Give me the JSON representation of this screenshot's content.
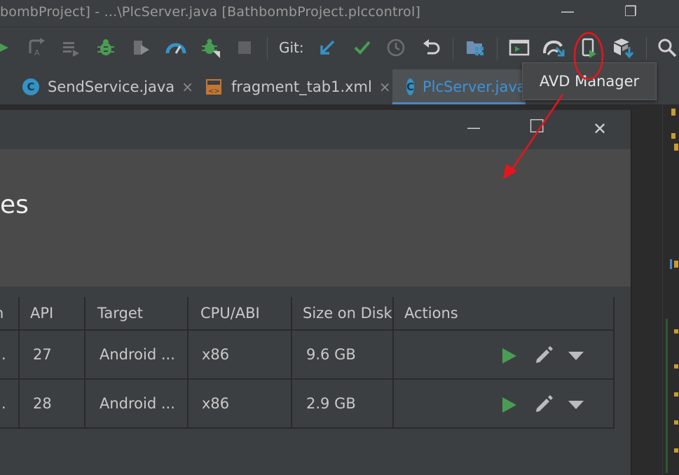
{
  "window": {
    "title": "bombProject] - ...\\PlcServer.java [BathbombProject.plccontrol]",
    "minimize_glyph": "—",
    "restore_glyph": "❐"
  },
  "toolbar": {
    "git_label": "Git:",
    "icons": [
      "run-icon",
      "rerun-icon",
      "coverage-icon",
      "debug-icon",
      "profile-icon",
      "speed-icon",
      "attach-debugger-icon",
      "stop-icon",
      "git-update-icon",
      "git-commit-icon",
      "git-history-icon",
      "revert-icon",
      "project-structure-icon",
      "terminal-icon",
      "sync-gradle-icon",
      "avd-manager-icon",
      "sdk-manager-icon",
      "search-icon"
    ]
  },
  "tabs": [
    {
      "label": "SendService.java",
      "icon": "class-icon",
      "close": "×"
    },
    {
      "label": "fragment_tab1.xml",
      "icon": "layout-icon",
      "close": "×"
    },
    {
      "label": "PlcServer.java",
      "icon": "class-icon",
      "close": ""
    }
  ],
  "tooltip": {
    "text": "AVD Manager"
  },
  "dialog": {
    "title_fragment": "es",
    "minimize_glyph": "—",
    "maximize_glyph": "☐",
    "close_glyph": "✕"
  },
  "table": {
    "columns": [
      "n",
      "API",
      "Target",
      "CPU/ABI",
      "Size on Disk",
      "Actions"
    ],
    "rows": [
      {
        "name_fragment": ".",
        "api": "27",
        "target": "Android ...",
        "cpu": "x86",
        "size": "9.6 GB"
      },
      {
        "name_fragment": ".",
        "api": "28",
        "target": "Android ...",
        "cpu": "x86",
        "size": "2.9 GB"
      }
    ]
  },
  "colors": {
    "accent_green": "#499c54",
    "accent_blue": "#3592c4",
    "annotation_red": "#e8141c"
  }
}
